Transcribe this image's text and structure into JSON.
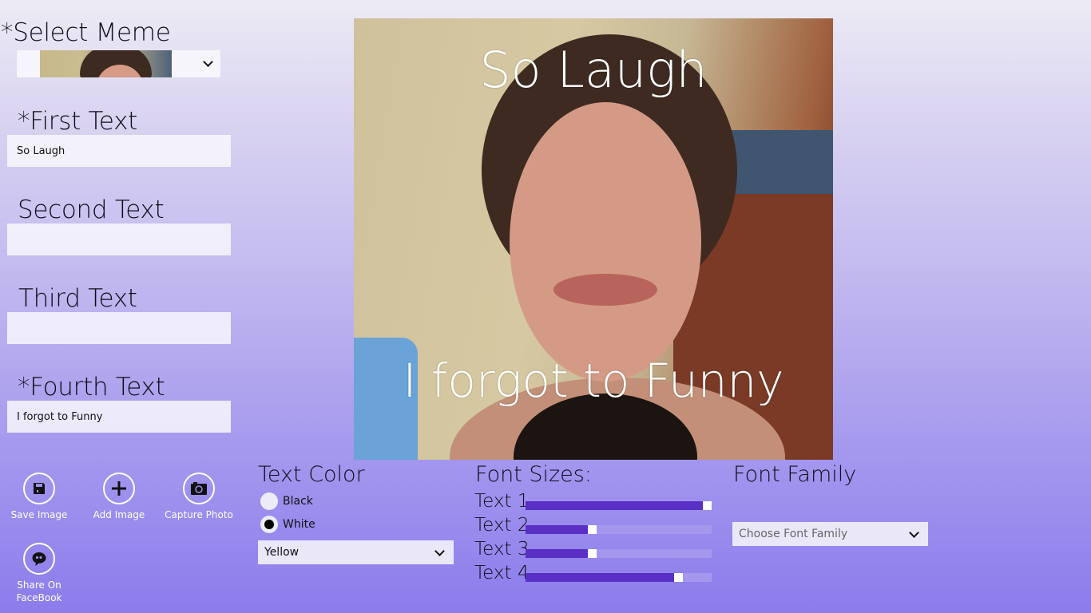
{
  "form": {
    "select_meme_label": "*Select Meme",
    "first_text_label": "*First Text",
    "first_text_value": "So Laugh",
    "second_text_label": "Second Text",
    "second_text_value": "",
    "third_text_label": "Third Text",
    "third_text_value": "",
    "fourth_text_label": "*Fourth Text",
    "fourth_text_value": "I forgot to Funny"
  },
  "meme": {
    "top_caption": "So Laugh",
    "bottom_caption": "I forgot to Funny",
    "caption_color": "#ffffff"
  },
  "actions": [
    {
      "label": "Save Image",
      "icon": "save-icon"
    },
    {
      "label": "Add Image",
      "icon": "plus-icon"
    },
    {
      "label": "Capture Photo",
      "icon": "camera-icon"
    },
    {
      "label": "Share On FaceBook",
      "icon": "chat-bubble-icon"
    }
  ],
  "text_color": {
    "title": "Text Color",
    "options": [
      {
        "label": "Black",
        "selected": false
      },
      {
        "label": "White",
        "selected": true
      }
    ],
    "dropdown_value": "Yellow"
  },
  "font_sizes": {
    "title": "Font Sizes:",
    "sliders": [
      {
        "label": "Text 1",
        "value": 1.0
      },
      {
        "label": "Text 2",
        "value": 0.35
      },
      {
        "label": "Text 3",
        "value": 0.35
      },
      {
        "label": "Text 4",
        "value": 0.84
      }
    ]
  },
  "font_family": {
    "title": "Font Family",
    "placeholder": "Choose Font Family"
  },
  "colors": {
    "slider_fill": "#5a2fc6",
    "slider_track": "#a597ee",
    "background_top": "#edebf5",
    "background_bottom": "#8b7cec"
  }
}
